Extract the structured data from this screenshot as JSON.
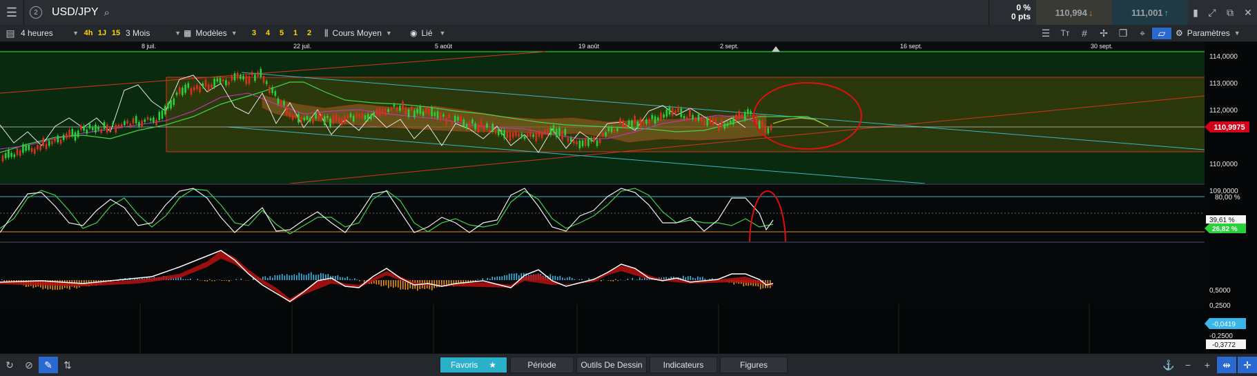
{
  "header": {
    "menu_icon": "hamburger-icon",
    "badge": "2",
    "symbol": "USD/JPY",
    "search_icon": "search-icon",
    "change_pct": "0 %",
    "change_pts": "0 pts",
    "sell_price": "110,994",
    "buy_price": "111,001",
    "colors": {
      "sell": "#b88f33",
      "buy": "#2ab0c8"
    }
  },
  "toolbar": {
    "interval": "4 heures",
    "interval_chips": [
      "4h",
      "1J",
      "15"
    ],
    "range": "3 Mois",
    "templates": "Modèles",
    "template_chips": [
      "3",
      "4",
      "5",
      "1",
      "2"
    ],
    "price_type": "Cours Moyen",
    "link": "Lié",
    "settings": "Paramètres"
  },
  "chart": {
    "date_labels": [
      "8 juil.",
      "22 juil.",
      "5 août",
      "19 août",
      "2 sept.",
      "16 sept.",
      "30 sept."
    ],
    "price_ticks": [
      "114,0000",
      "113,0000",
      "112,0000",
      "111,0000",
      "110,0000",
      "109,0000"
    ],
    "current_price": "110,9975",
    "stoch_ticks": [
      "80,00 %"
    ],
    "stoch_values": [
      "39,61 %",
      "26,82 %"
    ],
    "macd_ticks": [
      "0,5000",
      "0,2500",
      "-0,2500"
    ],
    "macd_values": [
      "-0,0419",
      "-0,3772"
    ],
    "colors": {
      "bg": "#0a2a10",
      "candle_up": "#2bd13a",
      "candle_down": "#d8321e",
      "cloud": "#6a4b1c",
      "stoch_line": "#f0f0f0",
      "stoch_signal": "#43d34a",
      "highlight_circle": "#e01010",
      "current_price_badge": "#d0021b"
    }
  },
  "bottom_tabs": [
    "Favoris",
    "Période",
    "Outils De Dessin",
    "Indicateurs",
    "Figures"
  ]
}
